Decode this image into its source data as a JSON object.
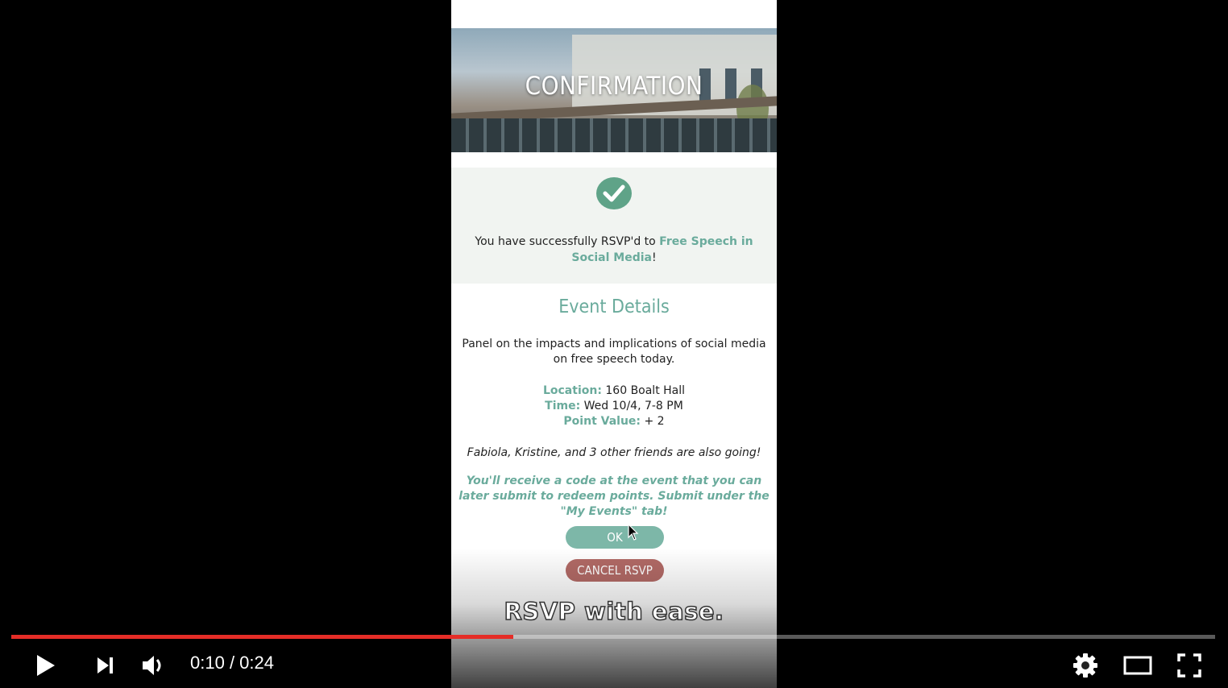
{
  "app": {
    "hero_title": "CONFIRMATION",
    "confirm": {
      "prefix": "You have successfully RSVP'd to ",
      "event_name": "Free Speech in Social Media",
      "suffix": "!"
    },
    "details": {
      "title": "Event Details",
      "description": "Panel on the impacts and implications of social media on free speech today.",
      "location_label": "Location:",
      "location_value": "160 Boalt Hall",
      "time_label": "Time:",
      "time_value": "Wed 10/4, 7-8 PM",
      "points_label": "Point Value:",
      "points_value": "+ 2",
      "friends": "Fabiola, Kristine, and 3 other friends are also going!",
      "note": "You'll receive a code at the event that you can later submit to redeem points. Submit under the \"My Events\" tab!"
    },
    "buttons": {
      "ok": "OK",
      "cancel": "CANCEL RSVP"
    },
    "accent_color": "#6aab9c",
    "cancel_color": "#b26a66"
  },
  "video": {
    "caption": "RSVP with ease.",
    "current_time": "0:10",
    "separator": " / ",
    "duration": "0:24",
    "progress_fraction": 0.4167,
    "progress_color": "#e52d27",
    "icons": [
      "play-icon",
      "next-icon",
      "volume-icon",
      "settings-icon",
      "theater-mode-icon",
      "fullscreen-icon"
    ]
  }
}
